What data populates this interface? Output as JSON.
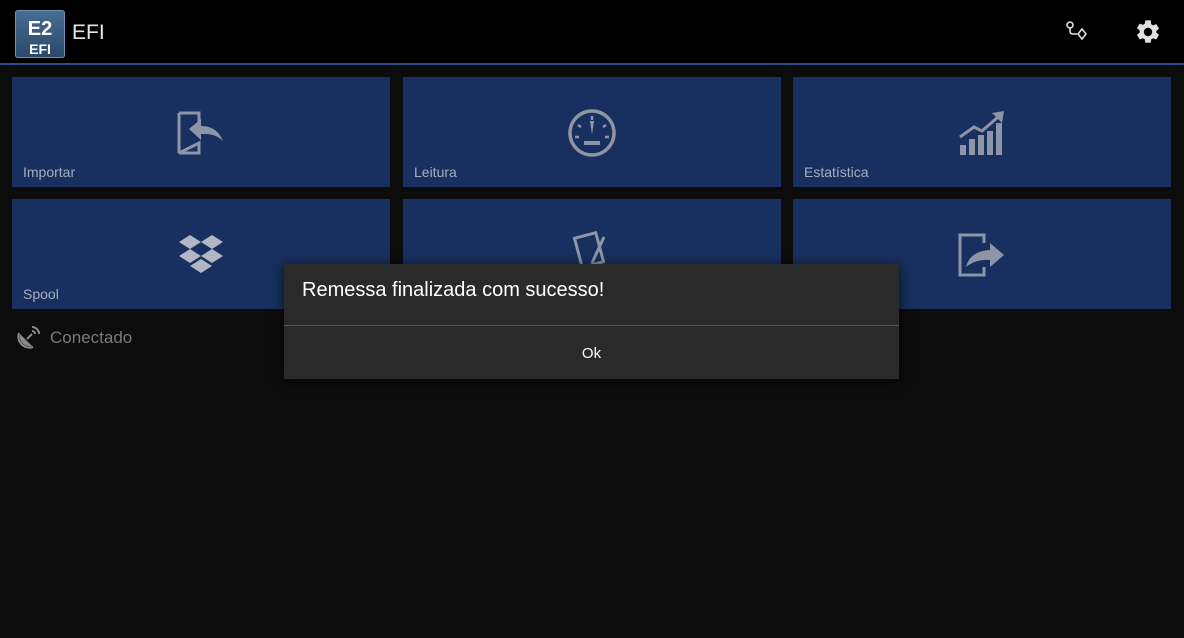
{
  "app": {
    "title": "EFI",
    "logo_text_top": "E2",
    "logo_text_bottom": "EFI",
    "accent_color": "#2f4a86",
    "tile_color": "#17305f"
  },
  "header": {
    "actions": [
      {
        "icon": "route-icon"
      },
      {
        "icon": "gear-icon"
      }
    ]
  },
  "tiles": [
    {
      "label": "Importar",
      "icon": "import-icon"
    },
    {
      "label": "Leitura",
      "icon": "gauge-icon"
    },
    {
      "label": "Estatística",
      "icon": "chart-growth-icon"
    },
    {
      "label": "Spool",
      "icon": "dropbox-icon"
    },
    {
      "label": "",
      "icon": "signature-icon"
    },
    {
      "label": "",
      "icon": "export-icon"
    }
  ],
  "status": {
    "text": "Conectado",
    "icon": "satellite-icon"
  },
  "dialog": {
    "message": "Remessa finalizada com sucesso!",
    "ok_label": "Ok"
  }
}
